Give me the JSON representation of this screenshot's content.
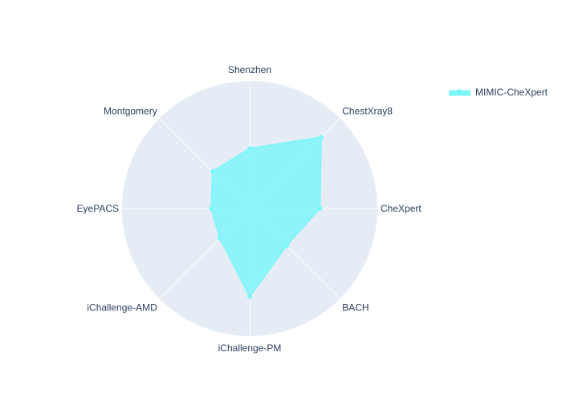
{
  "chart_data": {
    "type": "radar",
    "categories": [
      "Shenzhen",
      "ChestXray8",
      "CheXpert",
      "BACH",
      "iChallenge-PM",
      "iChallenge-AMD",
      "EyePACS",
      "Montgomery"
    ],
    "series": [
      {
        "name": "MIMIC-CheXpert",
        "values": [
          0.47,
          0.79,
          0.55,
          0.41,
          0.69,
          0.33,
          0.3,
          0.41
        ],
        "color": "#7ff6f9",
        "fill": "toself"
      }
    ],
    "rlim": [
      0,
      1
    ],
    "grid": true,
    "legend_position": "top-right",
    "background_color": "#e5ecf6",
    "gridline_color": "#ffffff",
    "font_color": "#2a3f5f"
  }
}
